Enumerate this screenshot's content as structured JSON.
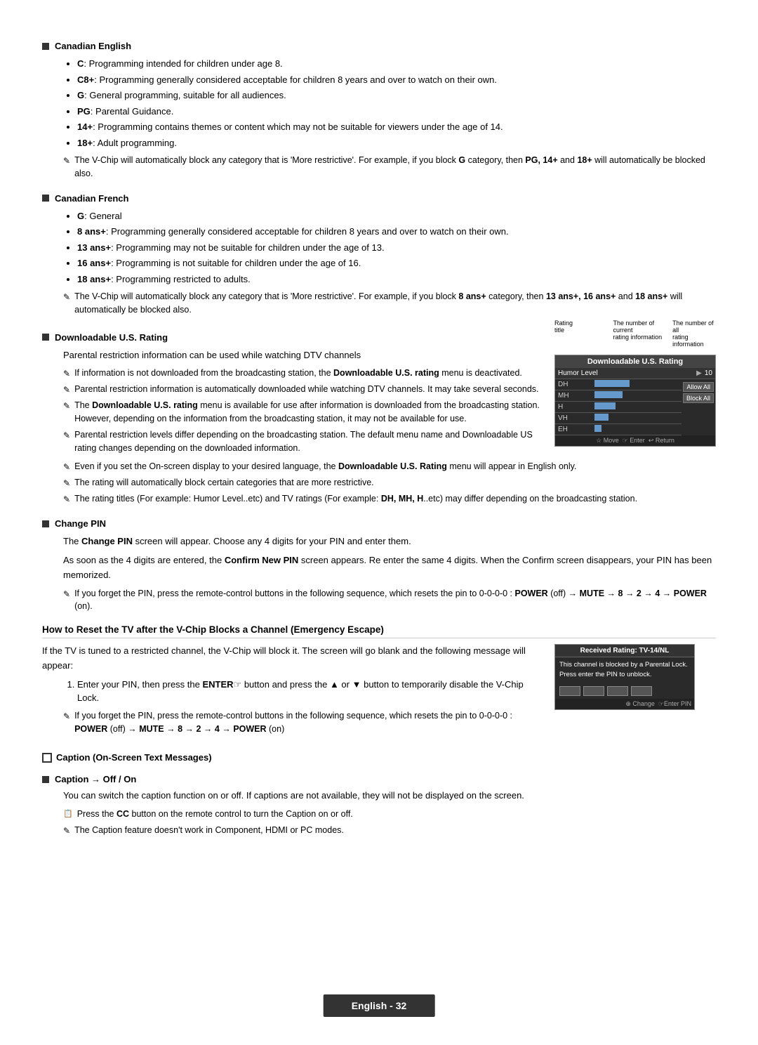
{
  "page": {
    "footer": "English - 32"
  },
  "sections": {
    "canadian_english": {
      "title": "Canadian English",
      "bullets": [
        "<b>C</b>: Programming intended for children under age 8.",
        "<b>C8+</b>: Programming generally considered acceptable for children 8 years and over to watch on their own.",
        "<b>G</b>: General programming, suitable for all audiences.",
        "<b>PG</b>: Parental Guidance.",
        "<b>14+</b>: Programming contains themes or content which may not be suitable for viewers under the age of 14.",
        "<b>18+</b>: Adult programming."
      ],
      "note": "The V-Chip will automatically block any category that is 'More restrictive'. For example, if you block <b>G</b> category, then <b>PG, 14+</b> and <b>18+</b> will automatically be blocked also."
    },
    "canadian_french": {
      "title": "Canadian French",
      "bullets": [
        "<b>G</b>: General",
        "<b>8 ans+</b>: Programming generally considered acceptable for children 8 years and over to watch on their own.",
        "<b>13 ans+</b>: Programming may not be suitable for children under the age of 13.",
        "<b>16 ans+</b>: Programming is not suitable for children under the age of 16.",
        "<b>18 ans+</b>: Programming restricted to adults."
      ],
      "note": "The V-Chip will automatically block any category that is 'More restrictive'. For example, if you block <b>8 ans+</b> category, then <b>13 ans+, 16 ans+</b> and <b>18 ans+</b> will automatically be blocked also."
    },
    "downloadable": {
      "title": "Downloadable U.S. Rating",
      "body": "Parental restriction information can be used while watching DTV channels",
      "notes": [
        "If information is not downloaded from the broadcasting station, the <b>Downloadable U.S. rating</b> menu is deactivated.",
        "Parental restriction information is automatically downloaded while watching DTV channels. It may take several seconds.",
        "The <b>Downloadable U.S. rating</b> menu is available for use after information is downloaded from the broadcasting station. However, depending on the information from the broadcasting station, it may not be available for use.",
        "Parental restriction levels differ depending on the broadcasting station. The default menu name and Downloadable US rating changes depending on the downloaded information.",
        "Even if you set the On-screen display to your desired language, the <b>Downloadable U.S. Rating</b> menu will appear in English only.",
        "The rating will automatically block certain categories that are more restrictive.",
        "The rating titles (For example: Humor Level..etc) and TV ratings (For example: <b>DH, MH, H</b>..etc) may differ depending on the broadcasting station."
      ],
      "widget": {
        "header": "Downloadable U.S. Rating",
        "top_labels": [
          "The number of current",
          "The number of all"
        ],
        "rating_title_label": "Rating title",
        "rating_info_label": "rating information",
        "all_info_label": "rating information",
        "rows": [
          {
            "label": "Humor Level",
            "value": "10",
            "has_arrow": true
          },
          {
            "label": "DH",
            "bar": 60
          },
          {
            "label": "MH",
            "bar": 40
          },
          {
            "label": "H",
            "bar": 20
          },
          {
            "label": "VH",
            "bar": 10
          },
          {
            "label": "EH",
            "bar": 5
          }
        ],
        "buttons": [
          "Allow All",
          "Block All"
        ],
        "footer": "☆ Move  ☞ Enter  ↩ Return"
      }
    },
    "change_pin": {
      "title": "Change PIN",
      "body1": "The <b>Change PIN</b> screen will appear. Choose any 4 digits for your PIN and enter them.",
      "body2": "As soon as the 4 digits are entered, the <b>Confirm New PIN</b> screen appears. Re enter the same 4 digits. When the Confirm screen disappears, your PIN has been memorized.",
      "note": "If you forget the PIN, press the remote-control buttons in the following sequence, which resets the pin to 0-0-0-0 : <b>POWER</b> (off) → <b>MUTE</b> → <b>8</b> → <b>2</b> → <b>4</b> → <b>POWER</b> (on)."
    },
    "emergency_escape": {
      "title": "How to Reset the TV after the V-Chip Blocks a Channel (Emergency Escape)",
      "body": "If the TV is tuned to a restricted channel, the V-Chip will block it. The screen will go blank and the following message will appear:",
      "steps": [
        "Enter your PIN, then press the <b>ENTER</b>☞ button and press the ▲ or ▼ button to temporarily disable the V-Chip Lock."
      ],
      "note": "If you forget the PIN, press the remote-control buttons in the following sequence, which resets the pin to 0-0-0-0 : <b>POWER</b> (off) → <b>MUTE</b> → <b>8</b> → <b>2</b> → <b>4</b> → <b>POWER</b> (on)",
      "widget": {
        "header": "Received Rating: TV-14/NL",
        "body": "This channel is blocked by a Parental Lock. Press enter the PIN to unblock.",
        "footer": "⊕ Change  ☞Enter PIN"
      }
    },
    "caption": {
      "title": "Caption (On-Screen Text Messages)",
      "subsection": "Caption → Off / On",
      "body": "You can switch the caption function on or off. If captions are not available, they will not be displayed on the screen.",
      "notes": [
        "Press the <b>CC</b> button on the remote control to turn the Caption on or off.",
        "The Caption feature doesn't work in Component, HDMI or PC modes."
      ]
    }
  }
}
